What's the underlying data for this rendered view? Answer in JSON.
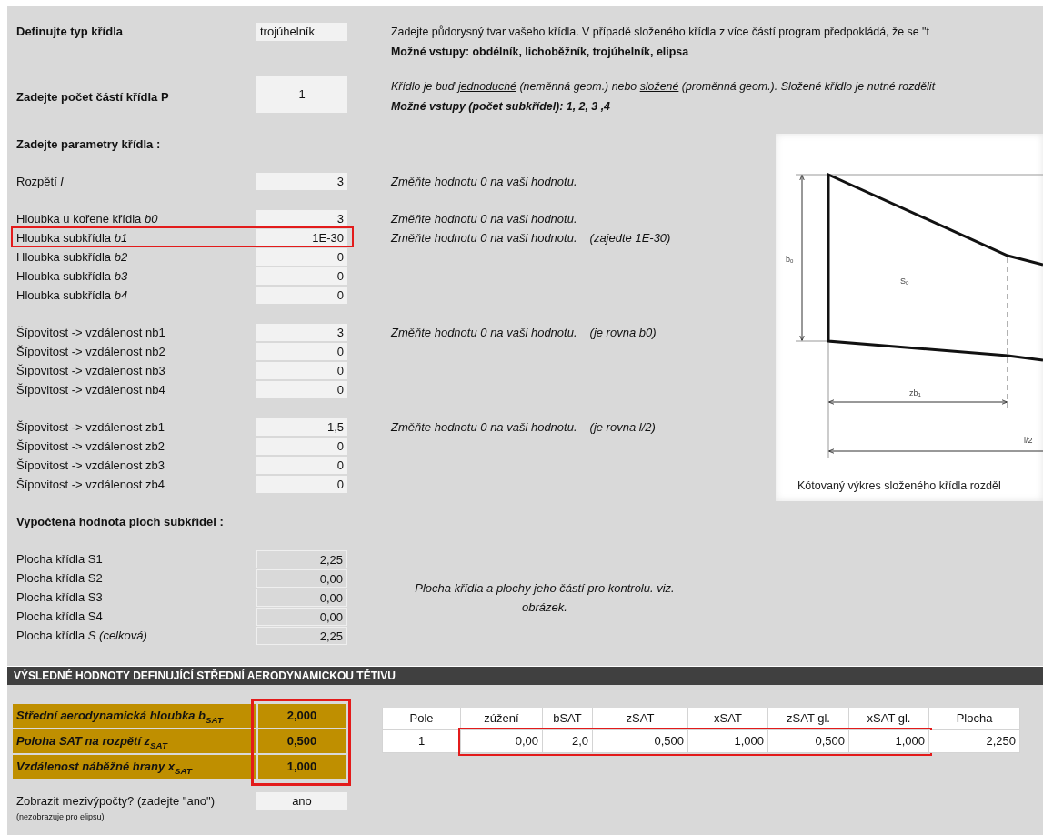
{
  "intro": [
    {
      "label": "Definujte typ křídla",
      "value": "trojúhelník",
      "notes": [
        {
          "segments": [
            {
              "text": "Zadejte půdorysný tvar vašeho křídla. V případě složeného křídla z více částí program předpokládá, že se \"t",
              "underlined": false
            }
          ]
        },
        {
          "segments": [
            {
              "text": "Možné vstupy: obdélník, lichoběžník, trojúhelník, elipsa",
              "underlined": false
            }
          ]
        }
      ]
    },
    {
      "label": "Zadejte počet částí křídla P",
      "value": "1",
      "notes": [
        {
          "segments": [
            {
              "text": "Křídlo je buď ",
              "underlined": false
            },
            {
              "text": "jednoduché",
              "underlined": true
            },
            {
              "text": " (neměnná geom.) nebo ",
              "underlined": false
            },
            {
              "text": "složené",
              "underlined": true
            },
            {
              "text": " (proměnná geom.). Složené křídlo je nutné rozdělit",
              "underlined": false
            }
          ]
        },
        {
          "segments": [
            {
              "text": "Možné vstupy (počet subkřídel): 1, 2, 3 ,4",
              "underlined": false
            }
          ]
        }
      ]
    }
  ],
  "params_heading": "Zadejte parametry křídla :",
  "param_groups": [
    {
      "rows": [
        {
          "label": "Rozpětí *l*",
          "value": "3",
          "note": "Změňte hodnotu 0 na vaši hodnotu.",
          "highlighted": false
        }
      ]
    },
    {
      "rows": [
        {
          "label": "Hloubka u kořene křídla *b0*",
          "value": "3",
          "note": "Změňte hodnotu 0 na vaši hodnotu.",
          "highlighted": false
        },
        {
          "label": "Hloubka subkřídla *b1*",
          "value": "1E-30",
          "note": "Změňte hodnotu 0 na vaši hodnotu.",
          "remark": "(zajedte 1E-30)",
          "highlighted": true
        },
        {
          "label": "Hloubka subkřídla *b2*",
          "value": "0",
          "highlighted": false
        },
        {
          "label": "Hloubka subkřídla *b3*",
          "value": "0",
          "highlighted": false
        },
        {
          "label": "Hloubka subkřídla *b4*",
          "value": "0",
          "highlighted": false
        }
      ]
    },
    {
      "rows": [
        {
          "label": "Šípovitost -> vzdálenost nb1",
          "value": "3",
          "note": "Změňte hodnotu 0 na vaši hodnotu.",
          "remark": "(je rovna b0)",
          "highlighted": false
        },
        {
          "label": "Šípovitost -> vzdálenost nb2",
          "value": "0",
          "highlighted": false
        },
        {
          "label": "Šípovitost -> vzdálenost nb3",
          "value": "0",
          "highlighted": false
        },
        {
          "label": "Šípovitost -> vzdálenost nb4",
          "value": "0",
          "highlighted": false
        }
      ]
    },
    {
      "rows": [
        {
          "label": "Šípovitost -> vzdálenost zb1",
          "value": "1,5",
          "note": "Změňte hodnotu 0 na vaši hodnotu.",
          "remark": "(je rovna l/2)",
          "highlighted": false
        },
        {
          "label": "Šípovitost -> vzdálenost zb2",
          "value": "0",
          "highlighted": false
        },
        {
          "label": "Šípovitost -> vzdálenost zb3",
          "value": "0",
          "highlighted": false
        },
        {
          "label": "Šípovitost -> vzdálenost zb4",
          "value": "0",
          "highlighted": false
        }
      ]
    }
  ],
  "areas_heading": "Vypočtená hodnota ploch subkřídel :",
  "areas": [
    {
      "label": "Plocha křídla S1",
      "value": "2,25"
    },
    {
      "label": "Plocha křídla S2",
      "value": "0,00"
    },
    {
      "label": "Plocha křídla S3",
      "value": "0,00"
    },
    {
      "label": "Plocha křídla S4",
      "value": "0,00"
    },
    {
      "label": "Plocha křídla *S (celková)*",
      "value": "2,25"
    }
  ],
  "areas_note": "Plocha křídla a plochy jeho částí pro kontrolu. viz. obrázek.",
  "diagram": {
    "b0": "b$_{0}$",
    "s0": "S$_{0}$",
    "zb1": "zb$_{1}$",
    "half_span": "l/2",
    "caption": "Kótovaný výkres složeného křídla rozděl"
  },
  "results_bar": "VÝSLEDNÉ HODNOTY DEFINUJÍCÍ STŘEDNÍ AERODYNAMICKOU TĚTIVU",
  "results": {
    "highlighted": true,
    "rows": [
      {
        "label": "Střední aerodynamická hloubka  b$_{SAT}$",
        "value": "2,000"
      },
      {
        "label": "Poloha SAT na rozpětí  z$_{SAT}$",
        "value": "0,500"
      },
      {
        "label": "Vzdálenost náběžné hrany  x$_{SAT}$",
        "value": "1,000"
      }
    ]
  },
  "table": {
    "columns": [
      "Pole",
      "zúžení",
      "bSAT",
      "zSAT",
      "xSAT",
      "zSAT gl.",
      "xSAT gl.",
      "Plocha"
    ],
    "rows": [
      {
        "cells": [
          {
            "text": "1",
            "framed": false
          },
          {
            "text": "0,00",
            "framed": true
          },
          {
            "text": "2,0",
            "framed": true
          },
          {
            "text": "0,500",
            "framed": true
          },
          {
            "text": "1,000",
            "framed": true
          },
          {
            "text": "0,500",
            "framed": true
          },
          {
            "text": "1,000",
            "framed": true
          },
          {
            "text": "2,250",
            "framed": false
          }
        ]
      }
    ]
  },
  "show_steps": {
    "label": "Zobrazit mezivýpočty? (zadejte \"ano\")",
    "value": "ano",
    "hint": "(nezobrazuje pro elipsu)"
  }
}
